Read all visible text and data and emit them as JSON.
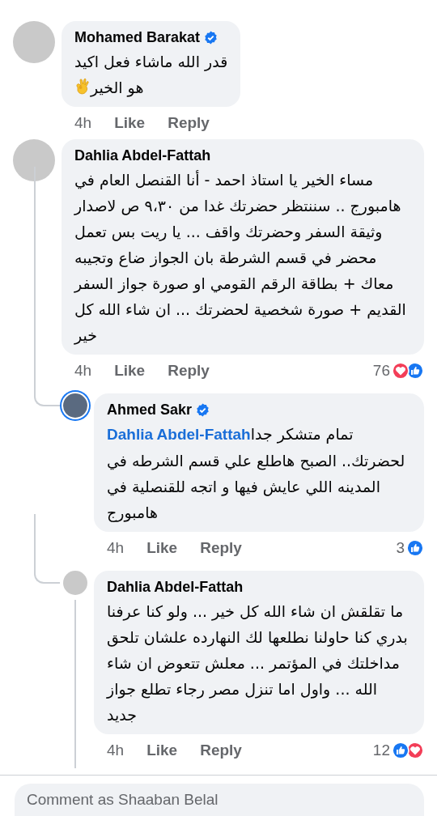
{
  "comments": [
    {
      "author": "Mohamed Barakat",
      "verified": true,
      "avatar_ring": false,
      "body": "قدر الله ماشاء فعل اكيد\nهو الخير",
      "trailing_emoji": {
        "kind": "ok_hand"
      },
      "time": "4h",
      "like_label": "Like",
      "reply_label": "Reply"
    },
    {
      "author": "Dahlia Abdel-Fattah",
      "verified": false,
      "avatar_ring": false,
      "body": "مساء الخير يا استاذ احمد - أنا القنصل العام في هامبورج .. سننتظر حضرتك غدا من ٩،٣٠ ص لاصدار وثيقة السفر وحضرتك واقف ... يا ريت بس تعمل محضر في قسم الشرطة بان الجواز ضاع وتجيبه معاك +  بطاقة الرقم القومي او صورة جواز السفر القديم + صورة شخصية  لحضرتك ... ان شاء الله كل خير",
      "time": "4h",
      "like_label": "Like",
      "reply_label": "Reply",
      "reaction_count": "76",
      "reactions": [
        {
          "kind": "love"
        },
        {
          "kind": "like"
        }
      ],
      "children": [
        {
          "author": "Ahmed Sakr",
          "verified": true,
          "avatar_ring": true,
          "mention": "Dahlia Abdel-Fattah",
          "body": "تمام متشكر جدا لحضرتك.. الصبح هاطلع علي قسم الشرطه في المدينه اللي عايش فيها و اتجه للقنصلية في هامبورج",
          "time": "4h",
          "like_label": "Like",
          "reply_label": "Reply",
          "reaction_count": "3",
          "reactions": [
            {
              "kind": "like"
            }
          ]
        },
        {
          "author": "Dahlia Abdel-Fattah",
          "verified": false,
          "avatar_ring": false,
          "body": "ما تقلقش ان شاء الله كل خير ... ولو كنا عرفنا بدري كنا حاولنا نطلعها لك النهارده علشان تلحق مداخلتك في المؤتمر ... معلش تتعوض ان شاء الله ... واول اما تنزل مصر رجاء تطلع جواز جديد",
          "time": "4h",
          "like_label": "Like",
          "reply_label": "Reply",
          "reaction_count": "12",
          "reactions": [
            {
              "kind": "like"
            },
            {
              "kind": "love"
            }
          ]
        }
      ]
    }
  ],
  "comment_box": {
    "placeholder": "Comment as Shaaban Belal"
  }
}
